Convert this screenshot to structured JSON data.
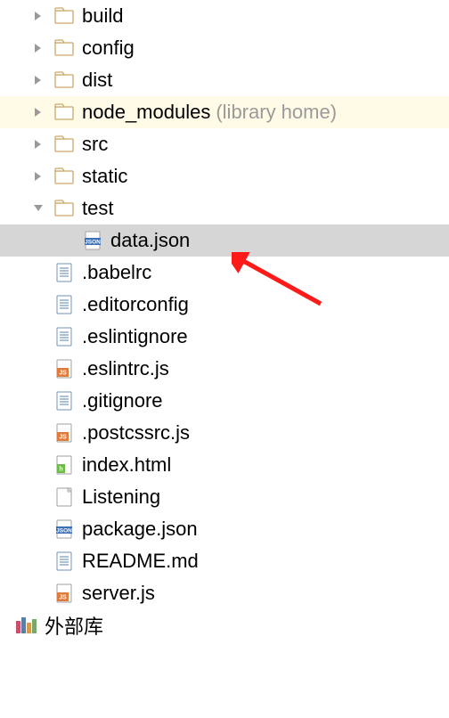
{
  "tree": {
    "items": [
      {
        "label": "build",
        "type": "folder",
        "expandable": true,
        "expanded": false,
        "depth": 0,
        "highlight": null,
        "annotation": null
      },
      {
        "label": "config",
        "type": "folder",
        "expandable": true,
        "expanded": false,
        "depth": 0,
        "highlight": null,
        "annotation": null
      },
      {
        "label": "dist",
        "type": "folder",
        "expandable": true,
        "expanded": false,
        "depth": 0,
        "highlight": null,
        "annotation": null
      },
      {
        "label": "node_modules",
        "type": "folder",
        "expandable": true,
        "expanded": false,
        "depth": 0,
        "highlight": "yellow",
        "annotation": "library home"
      },
      {
        "label": "src",
        "type": "folder",
        "expandable": true,
        "expanded": false,
        "depth": 0,
        "highlight": null,
        "annotation": null
      },
      {
        "label": "static",
        "type": "folder",
        "expandable": true,
        "expanded": false,
        "depth": 0,
        "highlight": null,
        "annotation": null
      },
      {
        "label": "test",
        "type": "folder",
        "expandable": true,
        "expanded": true,
        "depth": 0,
        "highlight": null,
        "annotation": null
      },
      {
        "label": "data.json",
        "type": "json",
        "expandable": false,
        "expanded": false,
        "depth": 1,
        "highlight": "selected",
        "annotation": null
      },
      {
        "label": ".babelrc",
        "type": "text",
        "expandable": false,
        "expanded": false,
        "depth": 0,
        "highlight": null,
        "annotation": null
      },
      {
        "label": ".editorconfig",
        "type": "text",
        "expandable": false,
        "expanded": false,
        "depth": 0,
        "highlight": null,
        "annotation": null
      },
      {
        "label": ".eslintignore",
        "type": "text",
        "expandable": false,
        "expanded": false,
        "depth": 0,
        "highlight": null,
        "annotation": null
      },
      {
        "label": ".eslintrc.js",
        "type": "js",
        "expandable": false,
        "expanded": false,
        "depth": 0,
        "highlight": null,
        "annotation": null
      },
      {
        "label": ".gitignore",
        "type": "text",
        "expandable": false,
        "expanded": false,
        "depth": 0,
        "highlight": null,
        "annotation": null
      },
      {
        "label": ".postcssrc.js",
        "type": "js",
        "expandable": false,
        "expanded": false,
        "depth": 0,
        "highlight": null,
        "annotation": null
      },
      {
        "label": "index.html",
        "type": "html",
        "expandable": false,
        "expanded": false,
        "depth": 0,
        "highlight": null,
        "annotation": null
      },
      {
        "label": "Listening",
        "type": "blank",
        "expandable": false,
        "expanded": false,
        "depth": 0,
        "highlight": null,
        "annotation": null
      },
      {
        "label": "package.json",
        "type": "json",
        "expandable": false,
        "expanded": false,
        "depth": 0,
        "highlight": null,
        "annotation": null
      },
      {
        "label": "README.md",
        "type": "text",
        "expandable": false,
        "expanded": false,
        "depth": 0,
        "highlight": null,
        "annotation": null
      },
      {
        "label": "server.js",
        "type": "js",
        "expandable": false,
        "expanded": false,
        "depth": 0,
        "highlight": null,
        "annotation": null
      }
    ]
  },
  "external_libraries_label": "外部库"
}
